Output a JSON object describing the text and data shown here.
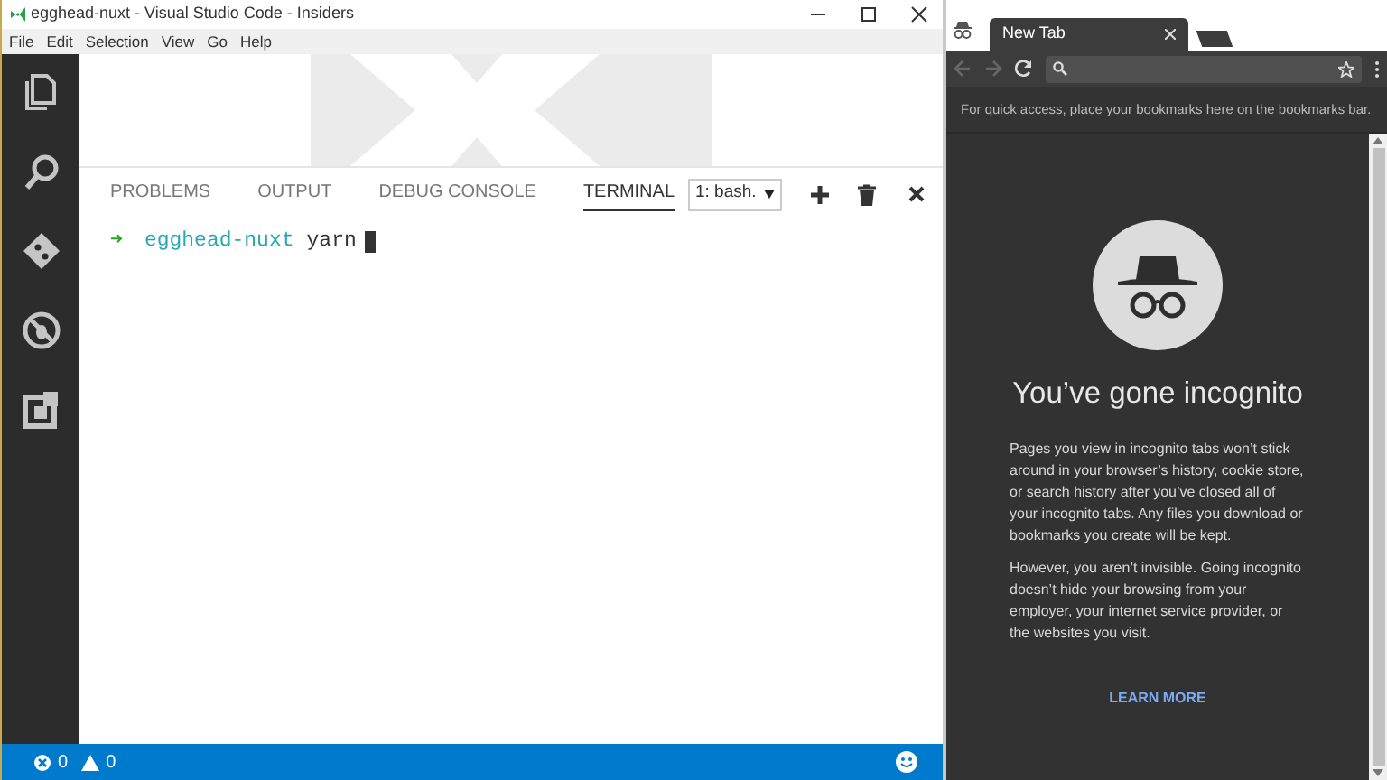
{
  "vscode": {
    "title": "egghead-nuxt - Visual Studio Code - Insiders",
    "menu": [
      "File",
      "Edit",
      "Selection",
      "View",
      "Go",
      "Help"
    ],
    "panel_tabs": [
      {
        "label": "PROBLEMS",
        "selected": false
      },
      {
        "label": "OUTPUT",
        "selected": false
      },
      {
        "label": "DEBUG CONSOLE",
        "selected": false
      },
      {
        "label": "TERMINAL",
        "selected": true
      }
    ],
    "terminal_select": "1: bash.",
    "terminal_line": {
      "prompt": "➜",
      "directory": "egghead-nuxt",
      "command": "yarn"
    },
    "status_bar": {
      "errors": "0",
      "warnings": "0"
    }
  },
  "browser": {
    "tab": "New Tab",
    "bookmarks_hint": "For quick access, place your bookmarks here on the bookmarks bar.",
    "heading": "You’ve gone incognito",
    "paragraphs": [
      "Pages you view in incognito tabs won’t stick around in your browser’s history, cookie store, or search history after you’ve closed all of your incognito tabs. Any files you download or bookmarks you create will be kept.",
      "However, you aren’t invisible. Going incognito doesn’t hide your browsing from your employer, your internet service provider, or the websites you visit."
    ],
    "link": "LEARN MORE"
  }
}
